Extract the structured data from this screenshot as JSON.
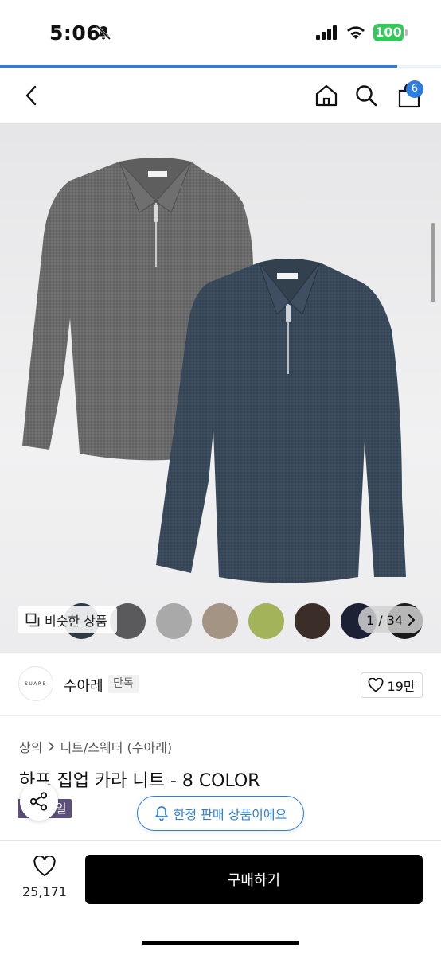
{
  "status_bar": {
    "time": "5:06",
    "battery": "100"
  },
  "page_scroll_progress": 0.9,
  "header": {
    "cart_count": "6"
  },
  "gallery": {
    "similar_label": "비슷한 상품",
    "pager": "1 / 34",
    "swatch_colors": [
      "#2f3a46",
      "#5a5a5c",
      "#a9a9a9",
      "#a39483",
      "#a3b35a",
      "#3b2e28",
      "#1d2136",
      "#1a1a1a"
    ]
  },
  "brand": {
    "logo_text": "SUARE",
    "name": "수아레",
    "tag": "단독",
    "like_count": "19만"
  },
  "product": {
    "breadcrumb": [
      "상의",
      "니트/스웨터 (수아레)"
    ],
    "title": "하프 집업 카라 니트 - 8 COLOR",
    "sale_tag": "세일",
    "limited_notice": "한정 판매 상품이에요"
  },
  "bottom_bar": {
    "wish_count": "25,171",
    "buy_label": "구매하기"
  },
  "colors": {
    "accent": "#2d7de0",
    "buy_button": "#000000",
    "battery": "#34c759"
  }
}
